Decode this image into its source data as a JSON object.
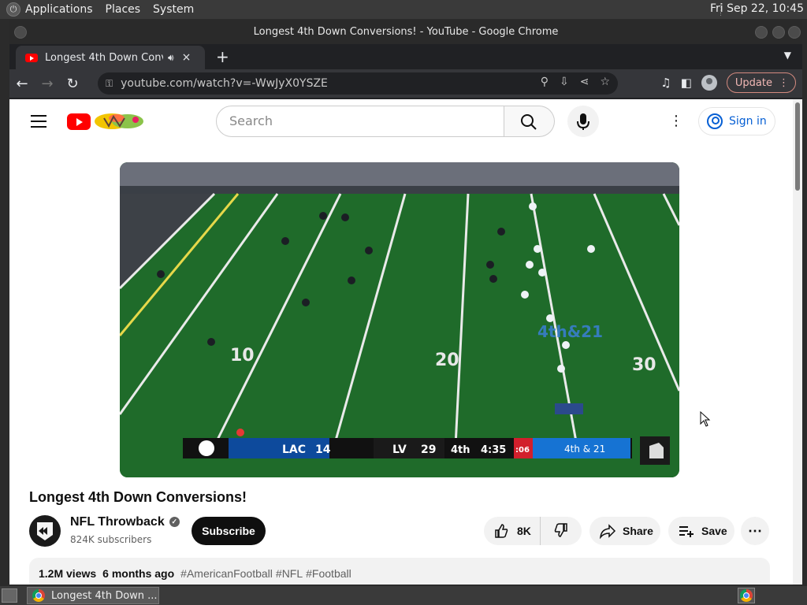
{
  "desktop": {
    "menus": [
      "Applications",
      "Places",
      "System"
    ],
    "clock": "Fri Sep 22, 10:45"
  },
  "window": {
    "title": "Longest 4th Down Conversions! - YouTube - Google Chrome"
  },
  "tab": {
    "title": "Longest 4th Down Conversions!",
    "audio_icon": "speaker-icon",
    "close": "×",
    "new_tab": "+"
  },
  "toolbar": {
    "url": "youtube.com/watch?v=-WwJyX0YSZE",
    "update_label": "Update"
  },
  "youtube": {
    "search_placeholder": "Search",
    "sign_in": "Sign in"
  },
  "scoreboard": {
    "team1": "LAC",
    "score1": "14",
    "team2": "LV",
    "score2": "29",
    "quarter": "4th",
    "clock": "4:35",
    "play_clock": ":06",
    "down": "4th & 21",
    "overlay": "4th&21",
    "yard_10": "10",
    "yard_20": "20",
    "yard_30": "30"
  },
  "video": {
    "title": "Longest 4th Down Conversions!",
    "channel": "NFL Throwback",
    "subscribers": "824K subscribers",
    "subscribe": "Subscribe",
    "likes": "8K",
    "share": "Share",
    "save": "Save",
    "views": "1.2M views",
    "age": "6 months ago",
    "tags": [
      "#AmericanFootball",
      "#NFL",
      "#Football"
    ]
  },
  "taskbar": {
    "task_label": "Longest 4th Down ..."
  },
  "colors": {
    "yt_red": "#ff0000",
    "link_blue": "#065fd4",
    "field_green": "#1e5a24"
  }
}
